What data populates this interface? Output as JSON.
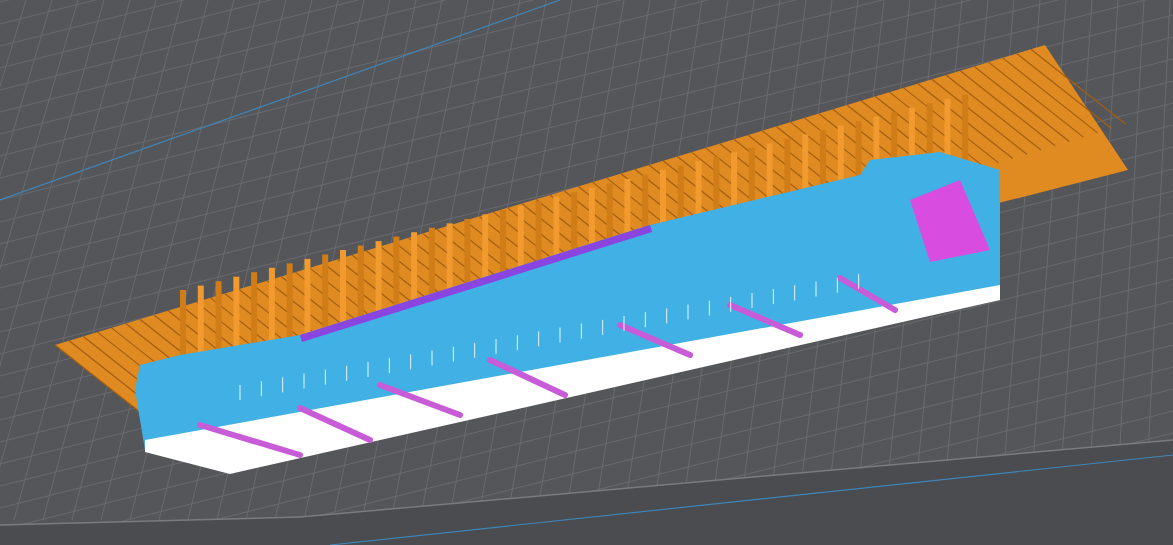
{
  "viewport": {
    "kind": "slicer-preview"
  }
}
